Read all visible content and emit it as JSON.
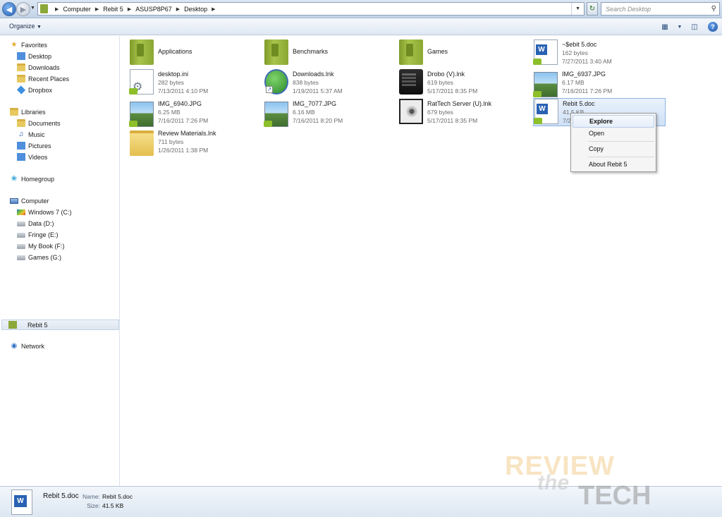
{
  "addressbar": {
    "breadcrumbs": [
      "Computer",
      "Rebit 5",
      "ASUSP8P67",
      "Desktop"
    ],
    "search_placeholder": "Search Desktop"
  },
  "toolbar": {
    "organize_label": "Organize"
  },
  "navpane": {
    "favorites_header": "Favorites",
    "favorites": [
      "Desktop",
      "Downloads",
      "Recent Places",
      "Dropbox"
    ],
    "libraries_header": "Libraries",
    "libraries": [
      "Documents",
      "Music",
      "Pictures",
      "Videos"
    ],
    "homegroup": "Homegroup",
    "computer_header": "Computer",
    "drives": [
      "Windows 7 (C:)",
      "Data (D:)",
      "Fringe (E:)",
      "My Book (F:)",
      "Games (G:)"
    ],
    "selected_item": "Rebit 5",
    "network": "Network"
  },
  "items": [
    {
      "name": "Applications",
      "size": "",
      "date": ""
    },
    {
      "name": "Benchmarks",
      "size": "",
      "date": ""
    },
    {
      "name": "Games",
      "size": "",
      "date": ""
    },
    {
      "name": "~$ebit 5.doc",
      "size": "162 bytes",
      "date": "7/27/2011 3:40 AM"
    },
    {
      "name": "desktop.ini",
      "size": "282 bytes",
      "date": "7/13/2011 4:10 PM"
    },
    {
      "name": "Downloads.lnk",
      "size": "838 bytes",
      "date": "1/19/2011 5:37 AM"
    },
    {
      "name": "Drobo (V).lnk",
      "size": "619 bytes",
      "date": "5/17/2011 8:35 PM"
    },
    {
      "name": "IMG_6937.JPG",
      "size": "6.17 MB",
      "date": "7/16/2011 7:26 PM"
    },
    {
      "name": "IMG_6940.JPG",
      "size": "6.25 MB",
      "date": "7/16/2011 7:26 PM"
    },
    {
      "name": "IMG_7077.JPG",
      "size": "6.16 MB",
      "date": "7/16/2011 8:20 PM"
    },
    {
      "name": "RatTech Server (U).lnk",
      "size": "679 bytes",
      "date": "5/17/2011 8:35 PM"
    },
    {
      "name": "Rebit 5.doc",
      "size": "41.5 KB",
      "date": "7/2"
    },
    {
      "name": "Review Materials.lnk",
      "size": "711 bytes",
      "date": "1/26/2011 1:38 PM"
    }
  ],
  "context_menu": {
    "items": [
      "Explore",
      "Open",
      "Copy",
      "About Rebit 5"
    ]
  },
  "details": {
    "file_name": "Rebit 5.doc",
    "name_label": "Name:",
    "name_value": "Rebit 5.doc",
    "size_label": "Size:",
    "size_value": "41.5 KB"
  },
  "watermark": {
    "line1": "REVIEW",
    "line2": "the",
    "line3": "TECH"
  },
  "colors": {
    "accent": "#2a62b3",
    "selection": "#cfe1f7",
    "library_green": "#8ca83a"
  }
}
